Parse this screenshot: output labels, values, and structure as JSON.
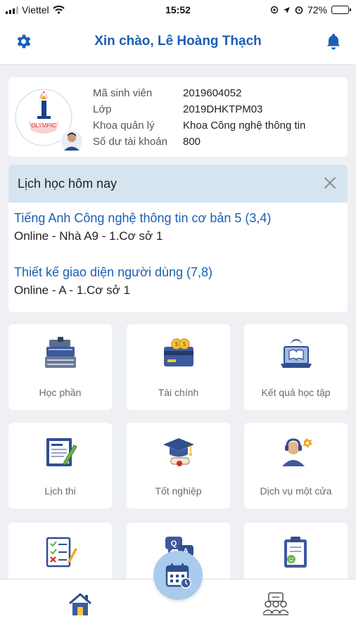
{
  "status_bar": {
    "carrier": "Viettel",
    "time": "15:52",
    "battery": "72%",
    "battery_level": 0.72
  },
  "header": {
    "greeting": "Xin chào, Lê Hoàng Thạch",
    "left_icon": "gear-icon",
    "right_icon": "bell-icon"
  },
  "profile": {
    "logo_text": "OLYMPIC",
    "rows": [
      {
        "label": "Mã sinh viên",
        "value": "2019604052"
      },
      {
        "label": "Lớp",
        "value": "2019DHKTPM03"
      },
      {
        "label": "Khoa quản lý",
        "value": "Khoa Công nghệ thông tin"
      },
      {
        "label": "Số dư tài khoản",
        "value": "800"
      }
    ]
  },
  "schedule": {
    "title": "Lịch học hôm nay",
    "courses": [
      {
        "name": "Tiếng Anh Công nghệ thông tin cơ bản 5 (3,4)",
        "location": "Online - Nhà A9 - 1.Cơ sở 1"
      },
      {
        "name": "Thiết kế giao diện người dùng (7,8)",
        "location": "Online - A - 1.Cơ sở 1"
      }
    ]
  },
  "menu": [
    {
      "label": "Học phần",
      "icon": "books-icon"
    },
    {
      "label": "Tài chính",
      "icon": "credit-card-icon"
    },
    {
      "label": "Kết quả học tập",
      "icon": "laptop-book-icon"
    },
    {
      "label": "Lịch thi",
      "icon": "exam-board-icon"
    },
    {
      "label": "Tốt nghiệp",
      "icon": "graduation-cap-icon"
    },
    {
      "label": "Dịch vụ một cửa",
      "icon": "support-agent-icon"
    },
    {
      "label": "",
      "icon": "checklist-icon"
    },
    {
      "label": "",
      "icon": "qa-chat-icon"
    },
    {
      "label": "",
      "icon": "survey-clipboard-icon"
    }
  ],
  "bottom_nav": {
    "left": "home-icon",
    "center": "calendar-icon",
    "right": "people-icon"
  },
  "colors": {
    "accent": "#1a5fb4",
    "schedule_header": "#d6e4f0",
    "fab": "#a9ccec"
  }
}
